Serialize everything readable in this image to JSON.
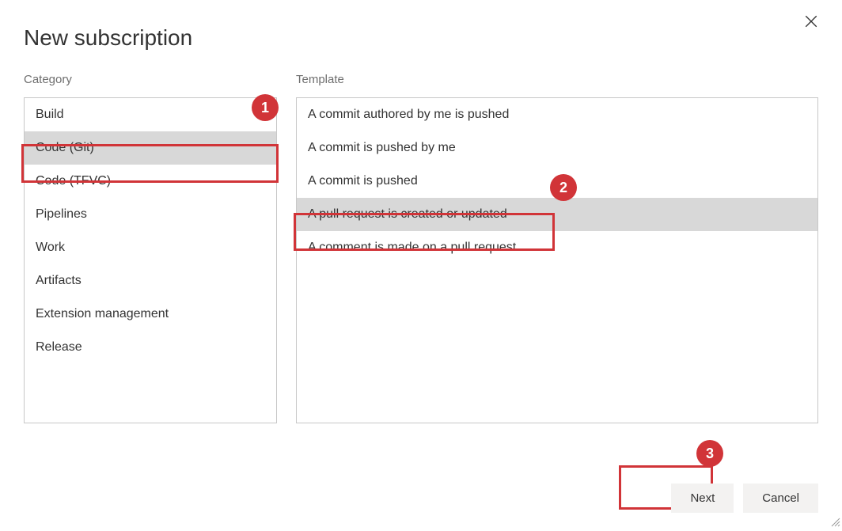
{
  "dialog": {
    "title": "New subscription"
  },
  "columns": {
    "category_label": "Category",
    "template_label": "Template"
  },
  "categories": [
    {
      "label": "Build"
    },
    {
      "label": "Code (Git)"
    },
    {
      "label": "Code (TFVC)"
    },
    {
      "label": "Pipelines"
    },
    {
      "label": "Work"
    },
    {
      "label": "Artifacts"
    },
    {
      "label": "Extension management"
    },
    {
      "label": "Release"
    }
  ],
  "templates": [
    {
      "label": "A commit authored by me is pushed"
    },
    {
      "label": "A commit is pushed by me"
    },
    {
      "label": "A commit is pushed"
    },
    {
      "label": "A pull request is created or updated"
    },
    {
      "label": "A comment is made on a pull request"
    }
  ],
  "footer": {
    "next_label": "Next",
    "cancel_label": "Cancel"
  },
  "annotations": {
    "marker1": "1",
    "marker2": "2",
    "marker3": "3"
  },
  "colors": {
    "highlight": "#d13438",
    "selected_bg": "#d8d8d8",
    "border": "#c8c8c8"
  }
}
